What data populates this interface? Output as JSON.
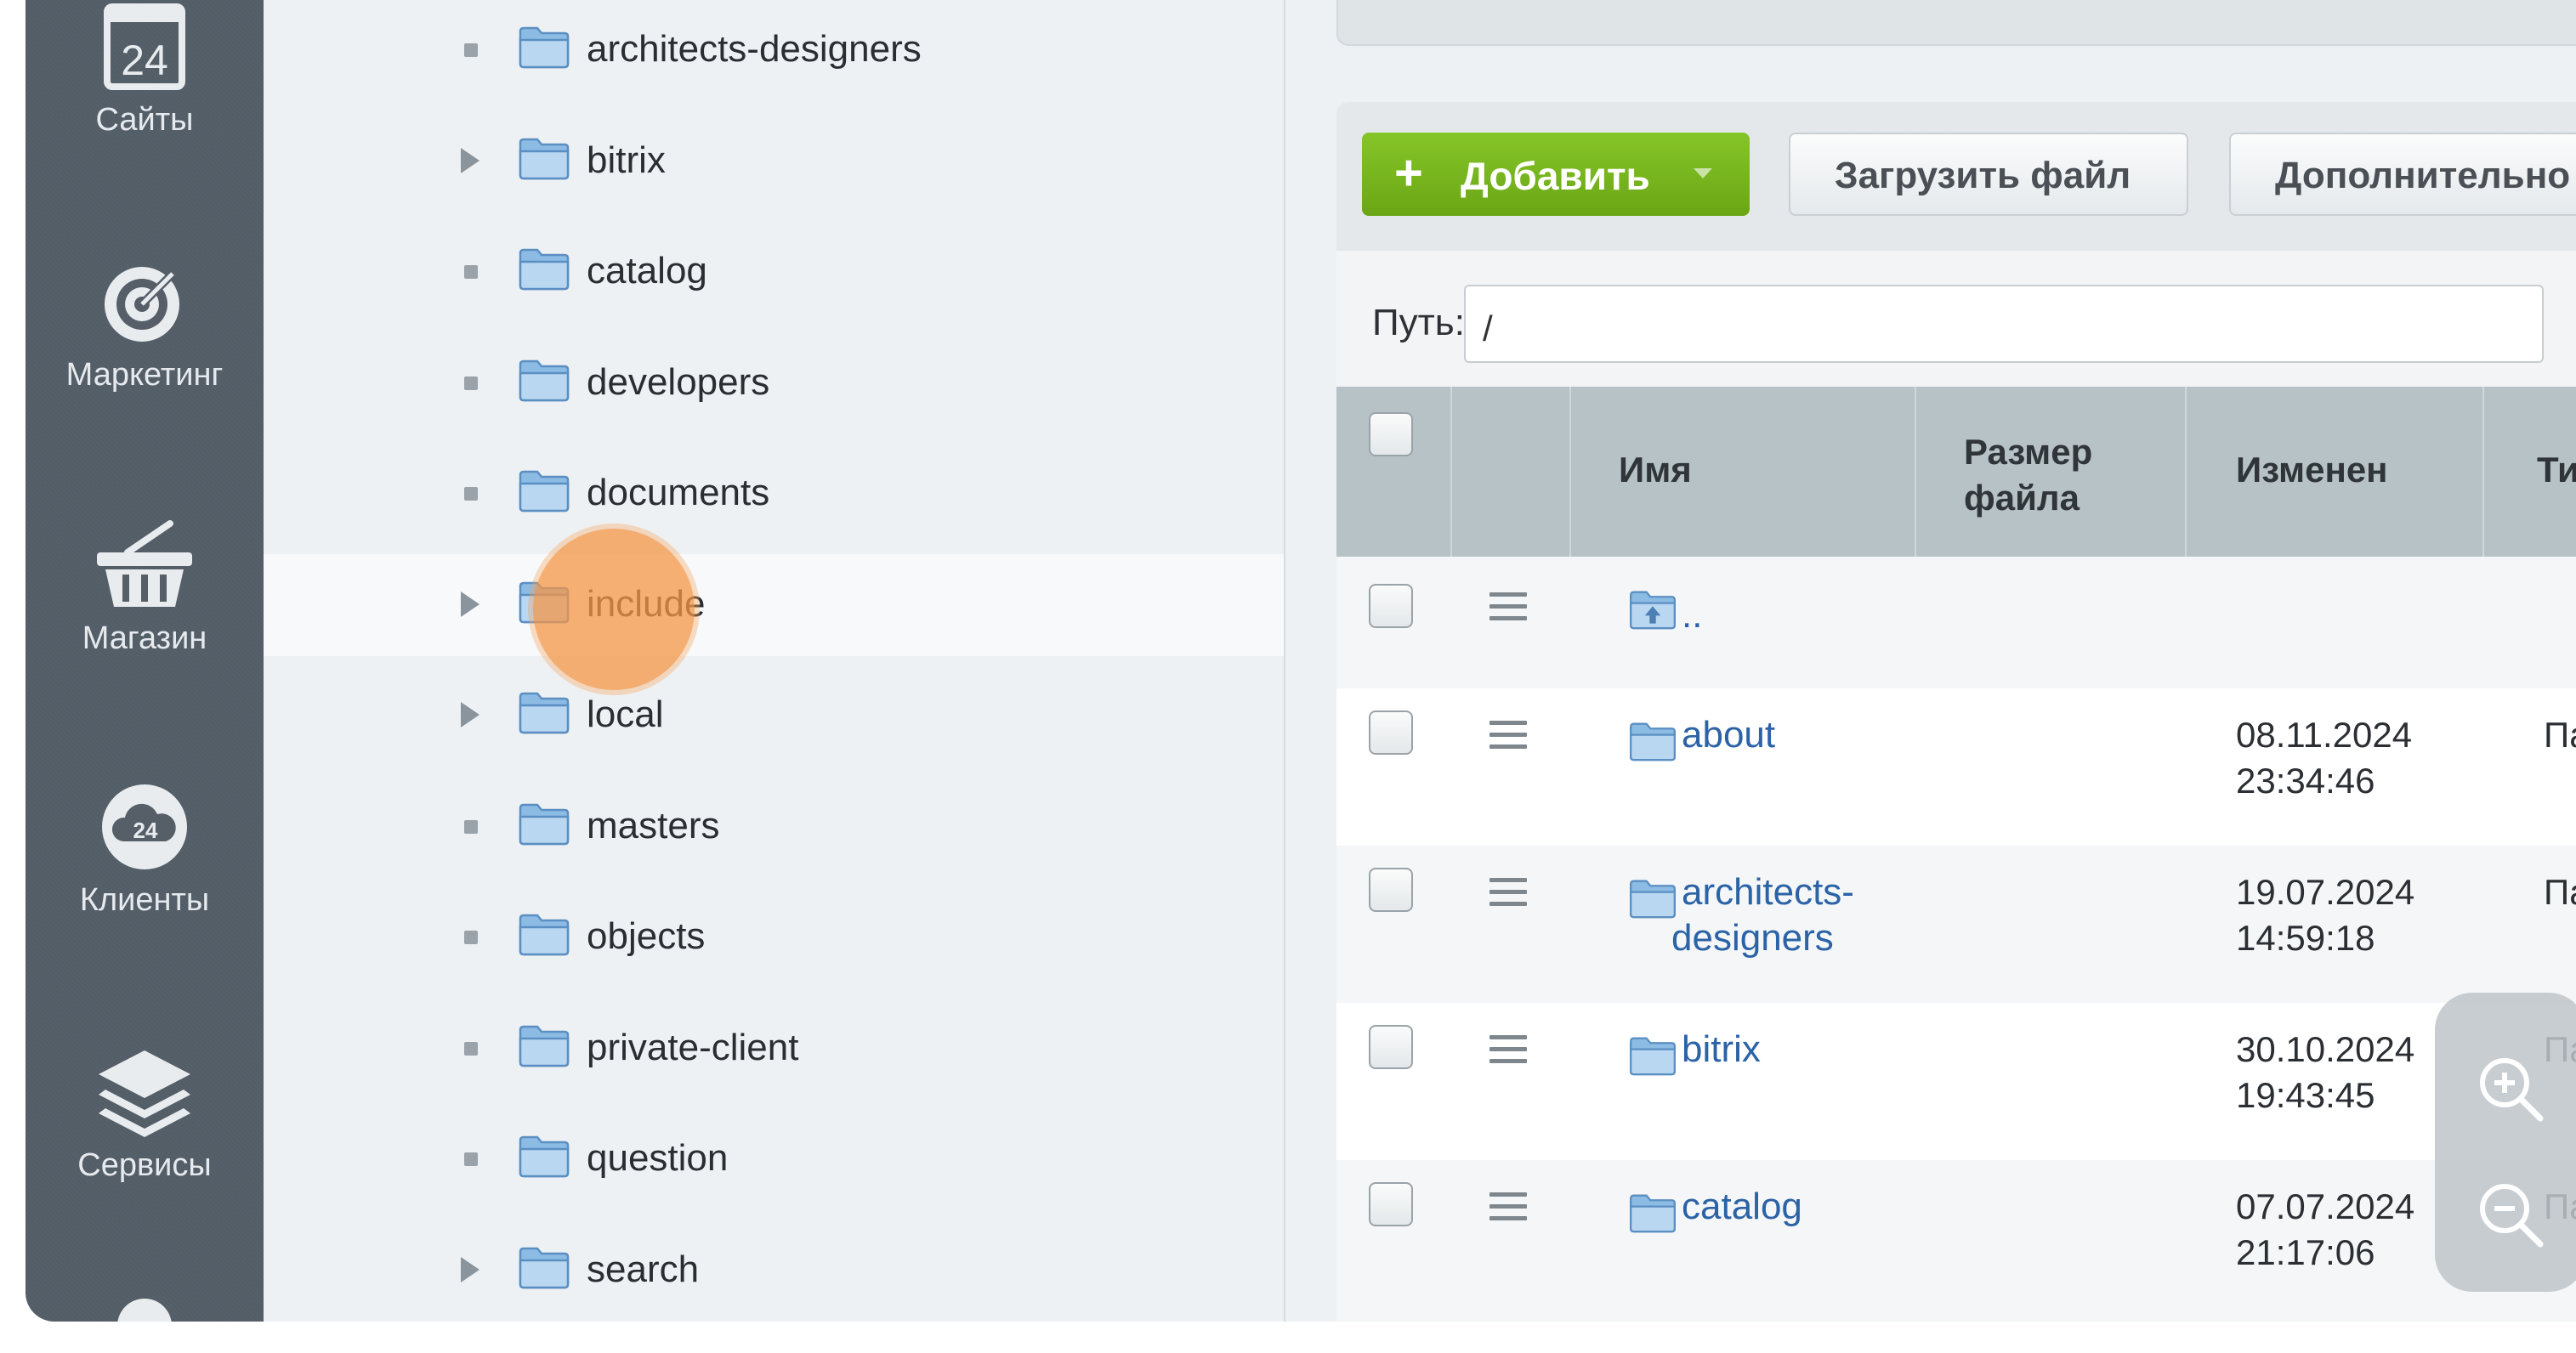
{
  "sidebar": {
    "items": [
      {
        "label": "Сайты",
        "icon": "calendar-24-icon"
      },
      {
        "label": "Маркетинг",
        "icon": "target-icon"
      },
      {
        "label": "Магазин",
        "icon": "basket-icon"
      },
      {
        "label": "Клиенты",
        "icon": "cloud-24-icon"
      },
      {
        "label": "Сервисы",
        "icon": "layers-icon"
      }
    ],
    "calendar_number": "24",
    "cloud_number": "24"
  },
  "tree": {
    "items": [
      {
        "name": "architects-designers",
        "expandable": false
      },
      {
        "name": "bitrix",
        "expandable": true
      },
      {
        "name": "catalog",
        "expandable": false
      },
      {
        "name": "developers",
        "expandable": false
      },
      {
        "name": "documents",
        "expandable": false
      },
      {
        "name": "include",
        "expandable": true,
        "highlighted": true
      },
      {
        "name": "local",
        "expandable": true
      },
      {
        "name": "masters",
        "expandable": false
      },
      {
        "name": "objects",
        "expandable": false
      },
      {
        "name": "private-client",
        "expandable": false
      },
      {
        "name": "question",
        "expandable": false
      },
      {
        "name": "search",
        "expandable": true
      }
    ]
  },
  "toolbar": {
    "add_label": "Добавить",
    "upload_label": "Загрузить файл",
    "more_label": "Дополнительно"
  },
  "path": {
    "label": "Путь:",
    "value": "/"
  },
  "table": {
    "headers": {
      "name": "Имя",
      "size_line1": "Размер",
      "size_line2": "файла",
      "modified": "Изменен",
      "type": "Тип"
    },
    "rows": [
      {
        "name": "..",
        "date": "",
        "time": "",
        "type": ""
      },
      {
        "name": "about",
        "date": "08.11.2024",
        "time": "23:34:46",
        "type": "Папка"
      },
      {
        "name": "architects-",
        "name2": "designers",
        "date": "19.07.2024",
        "time": "14:59:18",
        "type": "Папка"
      },
      {
        "name": "bitrix",
        "date": "30.10.2024",
        "time": "19:43:45",
        "type": "Папка"
      },
      {
        "name": "catalog",
        "date": "07.07.2024",
        "time": "21:17:06",
        "type": "Папка"
      }
    ]
  },
  "colors": {
    "rail": "#555f68",
    "add_button": "#78b51e",
    "link": "#2b63a6",
    "marker": "#f59646"
  }
}
